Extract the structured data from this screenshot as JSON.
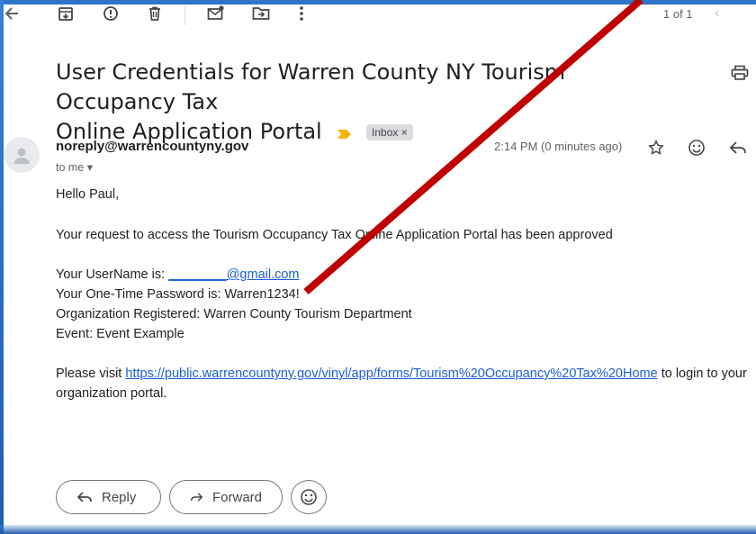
{
  "toolbar": {
    "icons": [
      "back-arrow-icon",
      "archive-icon",
      "report-spam-icon",
      "delete-icon",
      "mark-unread-icon",
      "move-to-icon",
      "more-vert-icon"
    ],
    "pager_text": "1 of 1"
  },
  "email": {
    "subject_line1": "User Credentials for Warren County NY Tourism Occupancy Tax",
    "subject_line2": "Online Application Portal",
    "label": "Inbox",
    "label_remove": "×",
    "sender": "noreply@warrencountyny.gov",
    "recipient": "to me",
    "time": "2:14 PM (0 minutes ago)",
    "greeting": "Hello Paul,",
    "approval": "Your request to access the Tourism Occupancy Tax Online Application Portal has been approved",
    "username_label": "Your UserName is: ",
    "username_value": "________@gmail.com",
    "password_line": "Your One-Time Password is: Warren1234!",
    "org_line": "Organization Registered: Warren County Tourism Department",
    "event_line": "Event: Event Example",
    "visit_prefix": "Please visit ",
    "portal_url": "https://public.warrencountyny.gov/vinyl/app/forms/Tourism%20Occupancy%20Tax%20Home",
    "visit_suffix": " to login to your",
    "visit_line2": "organization portal."
  },
  "actions": {
    "reply_label": "Reply",
    "forward_label": "Forward"
  },
  "colors": {
    "link": "#1a5fd6",
    "annotation_line": "#c00000",
    "frame": "#2f74c9",
    "important_marker": "#f4b400"
  }
}
